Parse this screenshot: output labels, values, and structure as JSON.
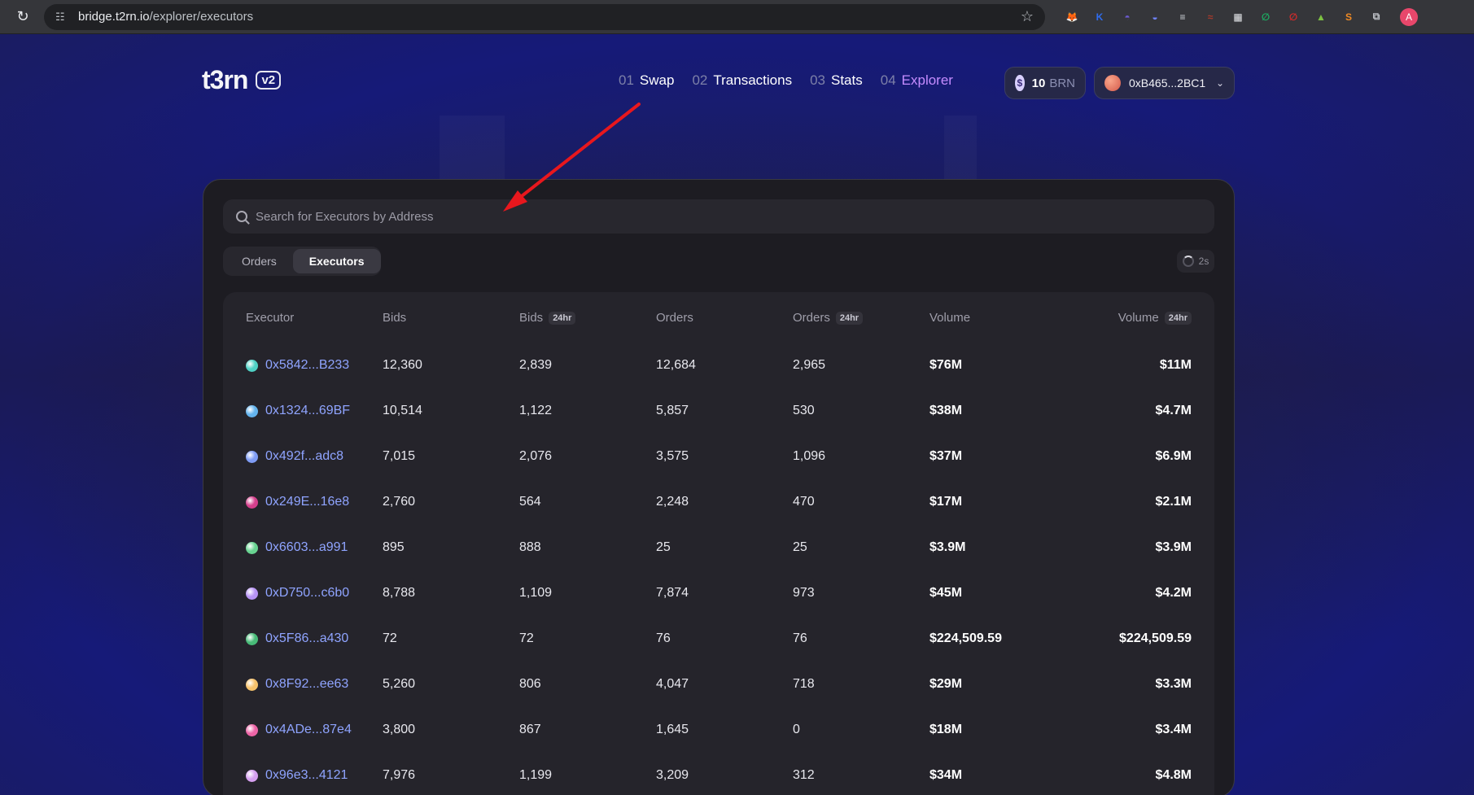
{
  "browser": {
    "url_host": "bridge.t2rn.io",
    "url_path": "/explorer/executors",
    "profile_initial": "A",
    "extensions": [
      {
        "name": "metamask",
        "color": "#e2761b",
        "glyph": "🦊"
      },
      {
        "name": "k-ext",
        "color": "#2f6df0",
        "glyph": "K"
      },
      {
        "name": "ghost",
        "color": "#6a5acd",
        "glyph": "◓"
      },
      {
        "name": "rabby",
        "color": "#7084ff",
        "glyph": "◒"
      },
      {
        "name": "stack",
        "color": "#cfd3d8",
        "glyph": "≡"
      },
      {
        "name": "wave",
        "color": "#a63a2b",
        "glyph": "≈"
      },
      {
        "name": "grid",
        "color": "#e8eaed",
        "glyph": "▦"
      },
      {
        "name": "leaf",
        "color": "#1cae62",
        "glyph": "∅"
      },
      {
        "name": "red-o",
        "color": "#d62b2b",
        "glyph": "∅"
      },
      {
        "name": "signal",
        "color": "#7dc242",
        "glyph": "▲"
      },
      {
        "name": "s-ext",
        "color": "#f08a24",
        "glyph": "S"
      },
      {
        "name": "puzzle",
        "color": "#bdc1c6",
        "glyph": "⧉"
      }
    ]
  },
  "header": {
    "logo": "t3rn",
    "version": "v2",
    "nav": [
      {
        "num": "01",
        "label": "Swap",
        "active": false
      },
      {
        "num": "02",
        "label": "Transactions",
        "active": false
      },
      {
        "num": "03",
        "label": "Stats",
        "active": false
      },
      {
        "num": "04",
        "label": "Explorer",
        "active": true
      }
    ],
    "balance": {
      "value": "10",
      "unit": "BRN"
    },
    "wallet": "0xB465...2BC1"
  },
  "search": {
    "placeholder": "Search for Executors by Address",
    "value": ""
  },
  "tabs": [
    {
      "label": "Orders",
      "active": false
    },
    {
      "label": "Executors",
      "active": true
    }
  ],
  "refresh": {
    "label": "2s"
  },
  "table": {
    "columns": [
      {
        "label": "Executor",
        "tag": ""
      },
      {
        "label": "Bids",
        "tag": ""
      },
      {
        "label": "Bids",
        "tag": "24hr"
      },
      {
        "label": "Orders",
        "tag": ""
      },
      {
        "label": "Orders",
        "tag": "24hr"
      },
      {
        "label": "Volume",
        "tag": ""
      },
      {
        "label": "Volume",
        "tag": "24hr"
      }
    ],
    "rows": [
      {
        "executor": "0x5842...B233",
        "icon_color": "#4fd1c5",
        "bids": "12,360",
        "bids_24h": "2,839",
        "orders": "12,684",
        "orders_24h": "2,965",
        "volume": "$76M",
        "volume_24h": "$11M"
      },
      {
        "executor": "0x1324...69BF",
        "icon_color": "#63b3ed",
        "bids": "10,514",
        "bids_24h": "1,122",
        "orders": "5,857",
        "orders_24h": "530",
        "volume": "$38M",
        "volume_24h": "$4.7M"
      },
      {
        "executor": "0x492f...adc8",
        "icon_color": "#7f9cf5",
        "bids": "7,015",
        "bids_24h": "2,076",
        "orders": "3,575",
        "orders_24h": "1,096",
        "volume": "$37M",
        "volume_24h": "$6.9M"
      },
      {
        "executor": "0x249E...16e8",
        "icon_color": "#d53f8c",
        "bids": "2,760",
        "bids_24h": "564",
        "orders": "2,248",
        "orders_24h": "470",
        "volume": "$17M",
        "volume_24h": "$2.1M"
      },
      {
        "executor": "0x6603...a991",
        "icon_color": "#68d391",
        "bids": "895",
        "bids_24h": "888",
        "orders": "25",
        "orders_24h": "25",
        "volume": "$3.9M",
        "volume_24h": "$3.9M"
      },
      {
        "executor": "0xD750...c6b0",
        "icon_color": "#b794f4",
        "bids": "8,788",
        "bids_24h": "1,109",
        "orders": "7,874",
        "orders_24h": "973",
        "volume": "$45M",
        "volume_24h": "$4.2M"
      },
      {
        "executor": "0x5F86...a430",
        "icon_color": "#48bb78",
        "bids": "72",
        "bids_24h": "72",
        "orders": "76",
        "orders_24h": "76",
        "volume": "$224,509.59",
        "volume_24h": "$224,509.59"
      },
      {
        "executor": "0x8F92...ee63",
        "icon_color": "#f6c26b",
        "bids": "5,260",
        "bids_24h": "806",
        "orders": "4,047",
        "orders_24h": "718",
        "volume": "$29M",
        "volume_24h": "$3.3M"
      },
      {
        "executor": "0x4ADe...87e4",
        "icon_color": "#ed64a6",
        "bids": "3,800",
        "bids_24h": "867",
        "orders": "1,645",
        "orders_24h": "0",
        "volume": "$18M",
        "volume_24h": "$3.4M"
      },
      {
        "executor": "0x96e3...4121",
        "icon_color": "#d6a0f0",
        "bids": "7,976",
        "bids_24h": "1,199",
        "orders": "3,209",
        "orders_24h": "312",
        "volume": "$34M",
        "volume_24h": "$4.8M"
      }
    ]
  },
  "colors": {
    "accent": "#c58cff",
    "address": "#8fa4ff",
    "annotation_arrow": "#e8171d"
  }
}
